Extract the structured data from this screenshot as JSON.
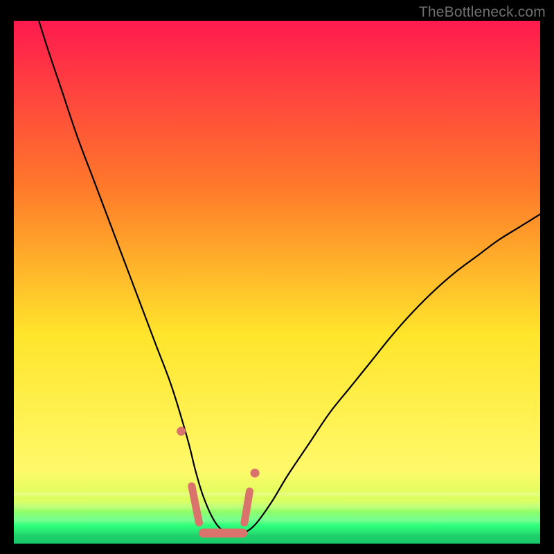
{
  "watermark": "TheBottleneck.com",
  "colors": {
    "frame": "#000000",
    "watermark": "#6f6f6f",
    "gradient_top": "#ff1a4e",
    "gradient_mid_upper": "#ff7a2a",
    "gradient_mid": "#ffe52b",
    "gradient_mid_lower": "#fff96a",
    "gradient_low": "#d6ff5a",
    "gradient_green": "#2cff7a",
    "curve": "#000000",
    "marker": "#d9736b"
  },
  "chart_data": {
    "type": "line",
    "title": "",
    "xlabel": "",
    "ylabel": "",
    "xlim": [
      0,
      100
    ],
    "ylim": [
      0,
      100
    ],
    "series": [
      {
        "name": "bottleneck-curve",
        "x": [
          0,
          3,
          6,
          9,
          12,
          15,
          18,
          21,
          24,
          27,
          30,
          33,
          34.5,
          36,
          38,
          40,
          42,
          43,
          44,
          46,
          49,
          52,
          56,
          60,
          64,
          68,
          72,
          76,
          80,
          84,
          88,
          92,
          96,
          100
        ],
        "y": [
          118,
          106,
          96,
          87,
          78,
          70,
          62,
          54,
          46,
          38,
          30,
          20,
          14,
          9,
          4.5,
          2.3,
          2.0,
          2.0,
          2.2,
          3.8,
          8,
          13,
          19,
          25,
          30,
          35,
          40,
          44.5,
          48.5,
          52,
          55,
          58,
          60.5,
          63
        ]
      }
    ],
    "markers": {
      "name": "bottom-flat-marker",
      "x": [
        33.2,
        34.2,
        36,
        38,
        40,
        42,
        43.5,
        44.3
      ],
      "y": [
        14,
        9,
        4.5,
        2.3,
        2.0,
        2.2,
        3.8,
        8
      ],
      "flat_segment": {
        "x0": 36,
        "x1": 43.5,
        "y": 2.0
      }
    }
  }
}
